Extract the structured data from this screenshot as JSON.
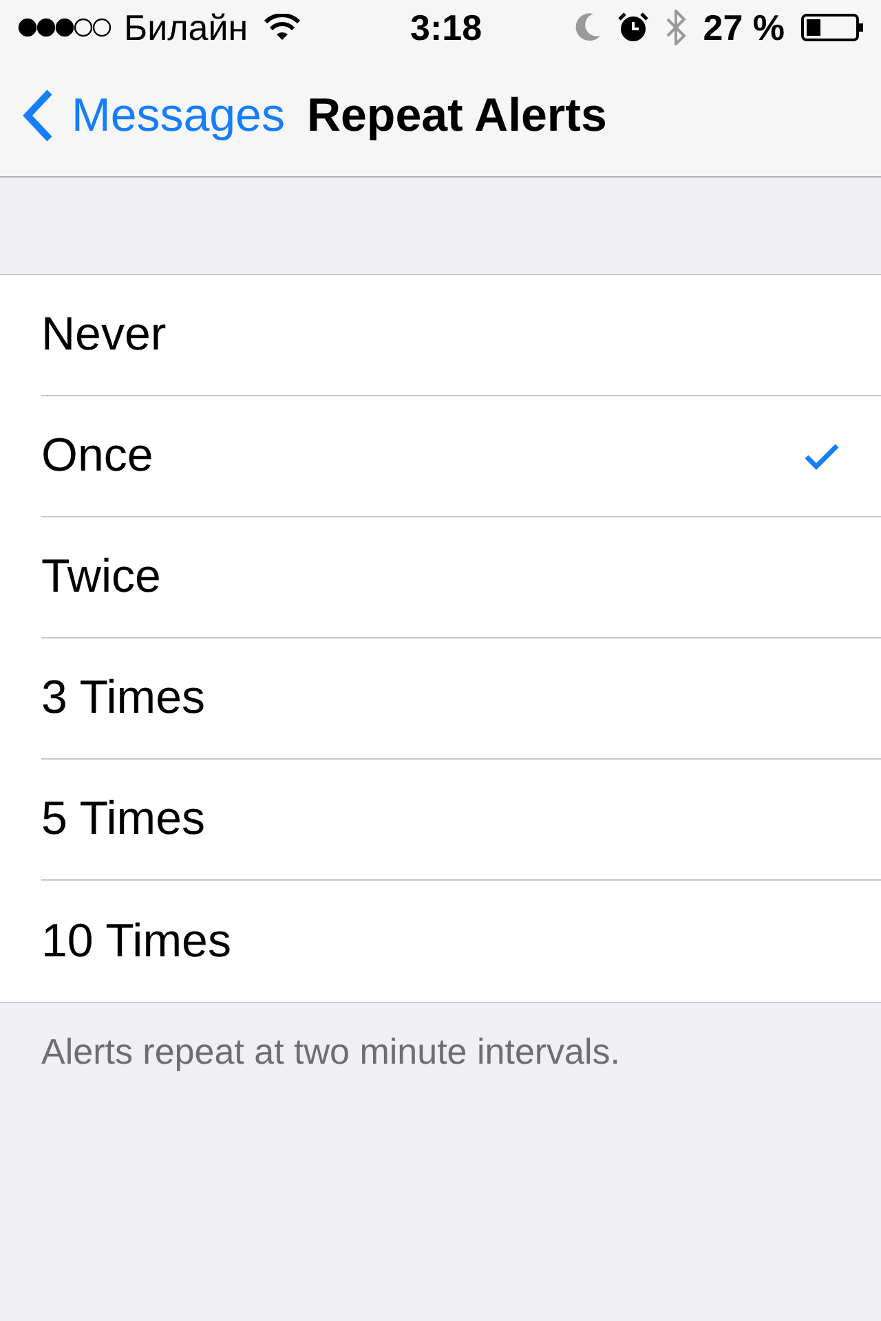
{
  "status_bar": {
    "carrier": "Билайн",
    "time": "3:18",
    "battery": "27 %"
  },
  "nav": {
    "back": "Messages",
    "title": "Repeat Alerts"
  },
  "options": [
    {
      "label": "Never",
      "selected": false
    },
    {
      "label": "Once",
      "selected": true
    },
    {
      "label": "Twice",
      "selected": false
    },
    {
      "label": "3 Times",
      "selected": false
    },
    {
      "label": "5 Times",
      "selected": false
    },
    {
      "label": "10 Times",
      "selected": false
    }
  ],
  "footer": "Alerts repeat at two minute intervals."
}
